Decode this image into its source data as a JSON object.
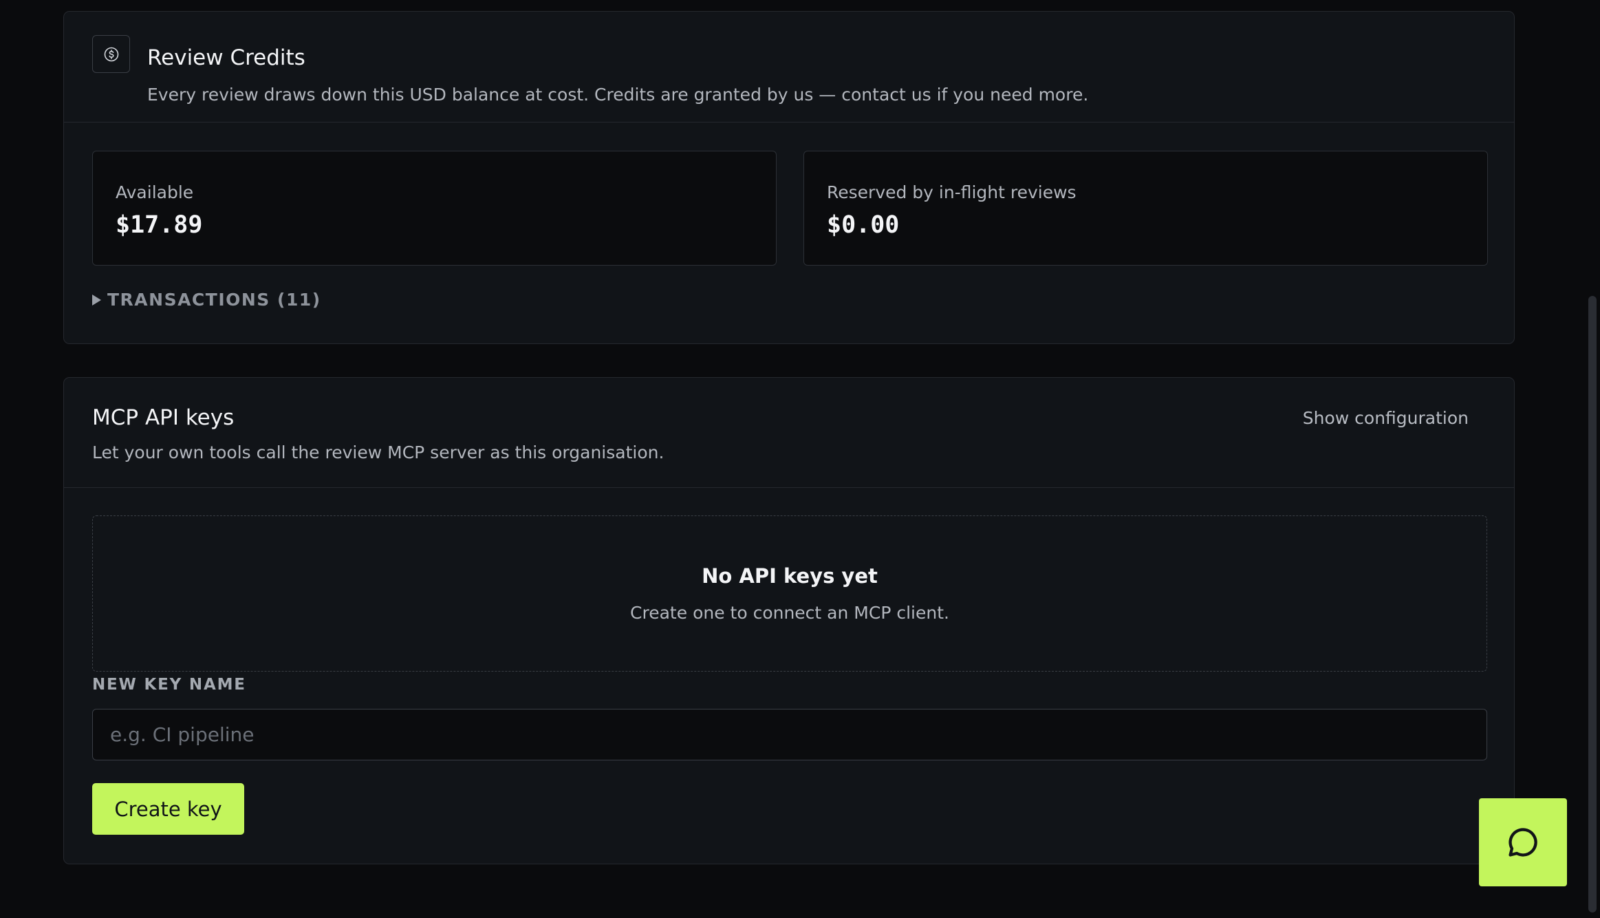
{
  "credits": {
    "title": "Review Credits",
    "description": "Every review draws down this USD balance at cost. Credits are granted by us — contact us if you need more.",
    "icon": "dollar-coin-icon",
    "available": {
      "label": "Available",
      "value": "$17.89"
    },
    "reserved": {
      "label": "Reserved by in-flight reviews",
      "value": "$0.00"
    },
    "transactions_label": "TRANSACTIONS (11)"
  },
  "mcp": {
    "title": "MCP API keys",
    "description": "Let your own tools call the review MCP server as this organisation.",
    "show_config_label": "Show configuration",
    "empty_title": "No API keys yet",
    "empty_description": "Create one to connect an MCP client.",
    "field_label": "NEW KEY NAME",
    "input_placeholder": "e.g. CI pipeline",
    "input_value": "",
    "create_button_label": "Create key"
  },
  "chat": {
    "icon": "chat-bubble-icon"
  },
  "colors": {
    "accent": "#c3f55c",
    "background": "#0a0b0d",
    "card": "#111418",
    "border": "#25282e"
  }
}
